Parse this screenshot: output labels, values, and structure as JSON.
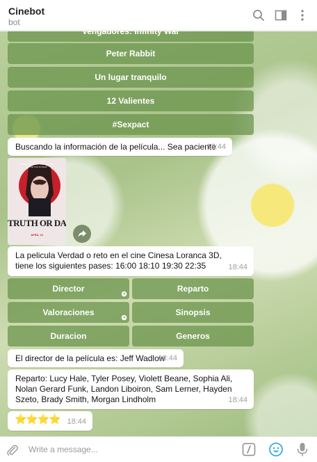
{
  "header": {
    "title": "Cinebot",
    "subtitle": "bot"
  },
  "keyboard_top": [
    "Vengadores: Infinity War",
    "Peter Rabbit",
    "Un lugar tranquilo",
    "12 Valientes",
    "#Sexpact"
  ],
  "messages": {
    "searching": {
      "text": "Buscando la información de la película... Sea paciente",
      "time": "18:44"
    },
    "poster": {
      "lines": [
        "THE PRODUCERS",
        "HAPPY DEATH DAY AND GET OUT",
        "INVITE YOU TO PLAY",
        "TRUTH OR DARE",
        "APRIL 13"
      ]
    },
    "showtimes": {
      "text": "La pelicula Verdad o reto en el cine Cinesa Loranca 3D, tiene los siguientes pases: 16:00 18:10 19:30 22:35",
      "time": "18:44"
    },
    "director": {
      "text": "El director de la película es: Jeff Wadlow",
      "time": "18:44"
    },
    "cast": {
      "text": "Reparto: Lucy Hale, Tyler Posey, Violett Beane, Sophia Ali, Nolan Gerard Funk, Landon Liboiron, Sam Lerner, Hayden Szeto, Brady Smith, Morgan Lindholm",
      "time": "18:44"
    },
    "rating": {
      "stars": "⭐⭐⭐⭐",
      "time": "18:44"
    }
  },
  "keyboard_info": [
    "Director",
    "Reparto",
    "Valoraciones",
    "Sinopsis",
    "Duracion",
    "Generos"
  ],
  "composer": {
    "placeholder": "Write a message..."
  },
  "icons": [
    "search-icon",
    "sidebar-toggle-icon",
    "more-vertical-icon",
    "clock-icon",
    "share-icon",
    "attach-icon",
    "bot-command-icon",
    "emoji-icon",
    "microphone-icon"
  ],
  "colors": {
    "keyboard_button": "#68924a",
    "emoji": "#3ea8e8"
  }
}
